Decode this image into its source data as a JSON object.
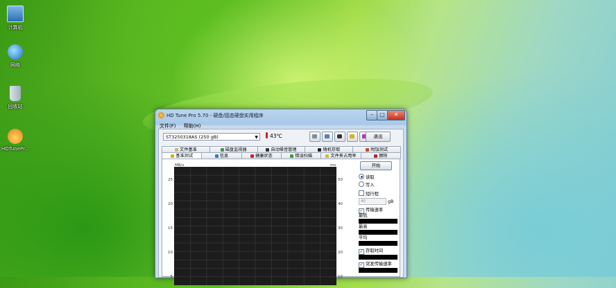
{
  "desktop": {
    "icons": [
      {
        "label": "计算机",
        "icon": "computer-icon"
      },
      {
        "label": "网络",
        "icon": "network-icon"
      },
      {
        "label": "回收站",
        "icon": "recycle-bin-icon"
      },
      {
        "label": "HDTunePr...",
        "icon": "hdtune-icon"
      }
    ]
  },
  "window": {
    "title": "HD Tune Pro 5.70 - 硬盘/固态硬盘实用程序",
    "controls": {
      "minimize": "–",
      "maximize": "□",
      "close": "✕"
    },
    "menu": [
      "文件(F)",
      "帮助(H)"
    ],
    "toolbar": {
      "drive": "ST3250318AS (250 gB)",
      "temperature": "43℃",
      "buttons": [
        "copy-icon",
        "copy-text-icon",
        "screenshot-icon",
        "options-icon",
        "info-icon"
      ],
      "exit": "退出"
    },
    "tabs_row1": [
      "文件基准",
      "磁盘监视器",
      "自动噪音管理",
      "随机存取",
      "附加测试"
    ],
    "tabs_row2": [
      "基准测试",
      "信息",
      "健康状态",
      "错误扫描",
      "文件夹占用率",
      "擦除"
    ],
    "active_tab": "基准测试",
    "chart": {
      "y_unit": "MB/s",
      "y_left_ticks": [
        "25",
        "20",
        "15",
        "10",
        "5"
      ],
      "y_right_unit": "ms",
      "y_right_ticks": [
        "50",
        "40",
        "30",
        "20",
        "10"
      ]
    },
    "side_panel": {
      "start": "开始",
      "read": "读取",
      "write": "写入",
      "short_stroke": "短行程",
      "short_stroke_value": "40",
      "short_stroke_unit": "gB",
      "transfer_rate": "传输速率",
      "min": "最低",
      "max": "最高",
      "avg": "平均",
      "access_time": "存取时间",
      "burst_rate": "突发传输速率"
    }
  },
  "colors": {
    "chart_bg": "#1c1c1c",
    "grid": "#3a3a3a"
  }
}
